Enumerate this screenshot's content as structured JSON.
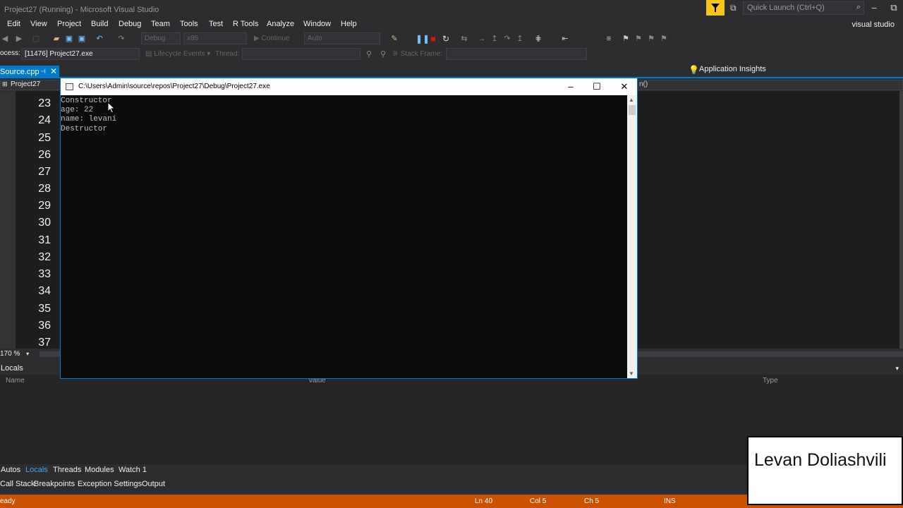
{
  "window": {
    "title": "Project27 (Running) - Microsoft Visual Studio",
    "quick_launch_placeholder": "Quick Launch (Ctrl+Q)",
    "account_label": "visual studio"
  },
  "menu": [
    "Edit",
    "View",
    "Project",
    "Build",
    "Debug",
    "Team",
    "Tools",
    "Test",
    "R Tools",
    "Analyze",
    "Window",
    "Help"
  ],
  "toolbar": {
    "config": "Debug",
    "platform": "x86",
    "continue_label": "Continue",
    "auto_label": "Auto",
    "app_insights": "Application Insights",
    "process_label": "ocess:",
    "process_value": "[11476] Project27.exe",
    "lifecycle_label": "Lifecycle Events",
    "thread_label": "Thread:",
    "stack_frame_label": "Stack Frame:"
  },
  "doc_tab": {
    "label": "Source.cpp",
    "project": "Project27",
    "right_nav": "n()"
  },
  "editor": {
    "line_numbers": [
      "23",
      "24",
      "25",
      "26",
      "27",
      "28",
      "29",
      "30",
      "31",
      "32",
      "33",
      "34",
      "35",
      "36",
      "37"
    ],
    "zoom": "170 %"
  },
  "console": {
    "title": "C:\\Users\\Admin\\source\\repos\\Project27\\Debug\\Project27.exe",
    "lines": [
      "Constructor",
      "age: 22",
      "name: levani",
      "Destructor"
    ]
  },
  "locals": {
    "title": "Locals",
    "columns": [
      "Name",
      "Value",
      "Type"
    ]
  },
  "bottom_tabs_row1": [
    "Autos",
    "Locals",
    "Threads",
    "Modules",
    "Watch 1"
  ],
  "bottom_tabs_row2": [
    "Call Stack",
    "Breakpoints",
    "Exception Settings",
    "Output"
  ],
  "status": {
    "ready": "eady",
    "ln": "Ln 40",
    "col": "Col 5",
    "ch": "Ch 5",
    "ins": "INS"
  },
  "watermark": "Levan Doliashvili",
  "colors": {
    "accent": "#007acc",
    "status_bar": "#ca5100",
    "filter": "#f5c518"
  }
}
